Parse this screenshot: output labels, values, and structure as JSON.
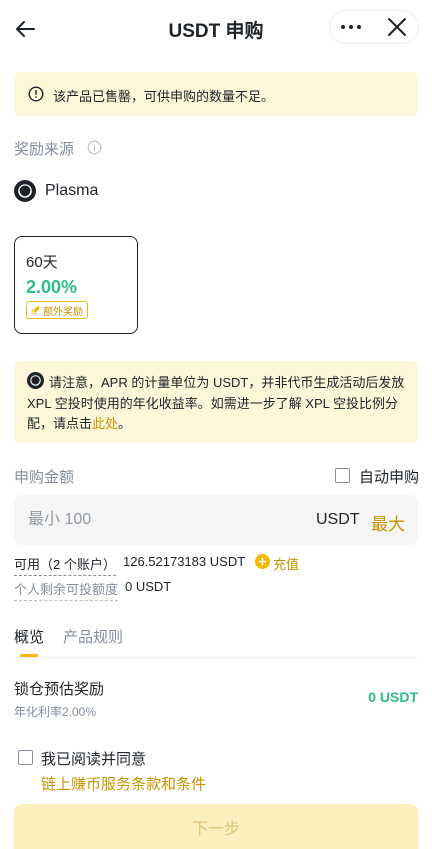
{
  "header": {
    "title": "USDT 申购",
    "back_icon": "arrow-left-icon",
    "more_icon": "more-dots-icon",
    "close_icon": "close-icon"
  },
  "notice": {
    "text": "该产品已售罄，可供申购的数量不足。",
    "icon": "warning-circle-icon"
  },
  "reward_source": {
    "label": "奖励来源",
    "provider": "Plasma"
  },
  "term_option": {
    "days": "60天",
    "apr": "2.00%",
    "badge": "额外奖励"
  },
  "apr_note": {
    "text": "请注意，APR 的计量单位为 USDT，并非代币生成活动后发放 XPL 空投时使用的年化收益率。如需进一步了解 XPL 空投比例分配，请点击",
    "link": "此处",
    "suffix": "。"
  },
  "amount": {
    "label": "申购金额",
    "auto_label": "自动申购",
    "placeholder": "最小 100",
    "currency": "USDT",
    "max_label": "最大",
    "available_label": "可用（2 个账户）",
    "available_value": "126.52173183 USDT",
    "topup_label": "充值",
    "quota_label": "个人剩余可投额度",
    "quota_value": "0 USDT"
  },
  "tabs": [
    {
      "label": "概览",
      "active": true
    },
    {
      "label": "产品规则",
      "active": false
    }
  ],
  "overview": {
    "reward_label": "锁仓预估奖励",
    "reward_sub": "年化利率2.00%",
    "reward_value": "0 USDT"
  },
  "agreement": {
    "text": "我已阅读并同意",
    "link": "链上赚币服务条款和条件"
  },
  "next_button": "下一步",
  "colors": {
    "accent": "#f0b90b",
    "link": "#c99400",
    "positive": "#2ebd85",
    "notice_bg": "#fef6d8"
  }
}
